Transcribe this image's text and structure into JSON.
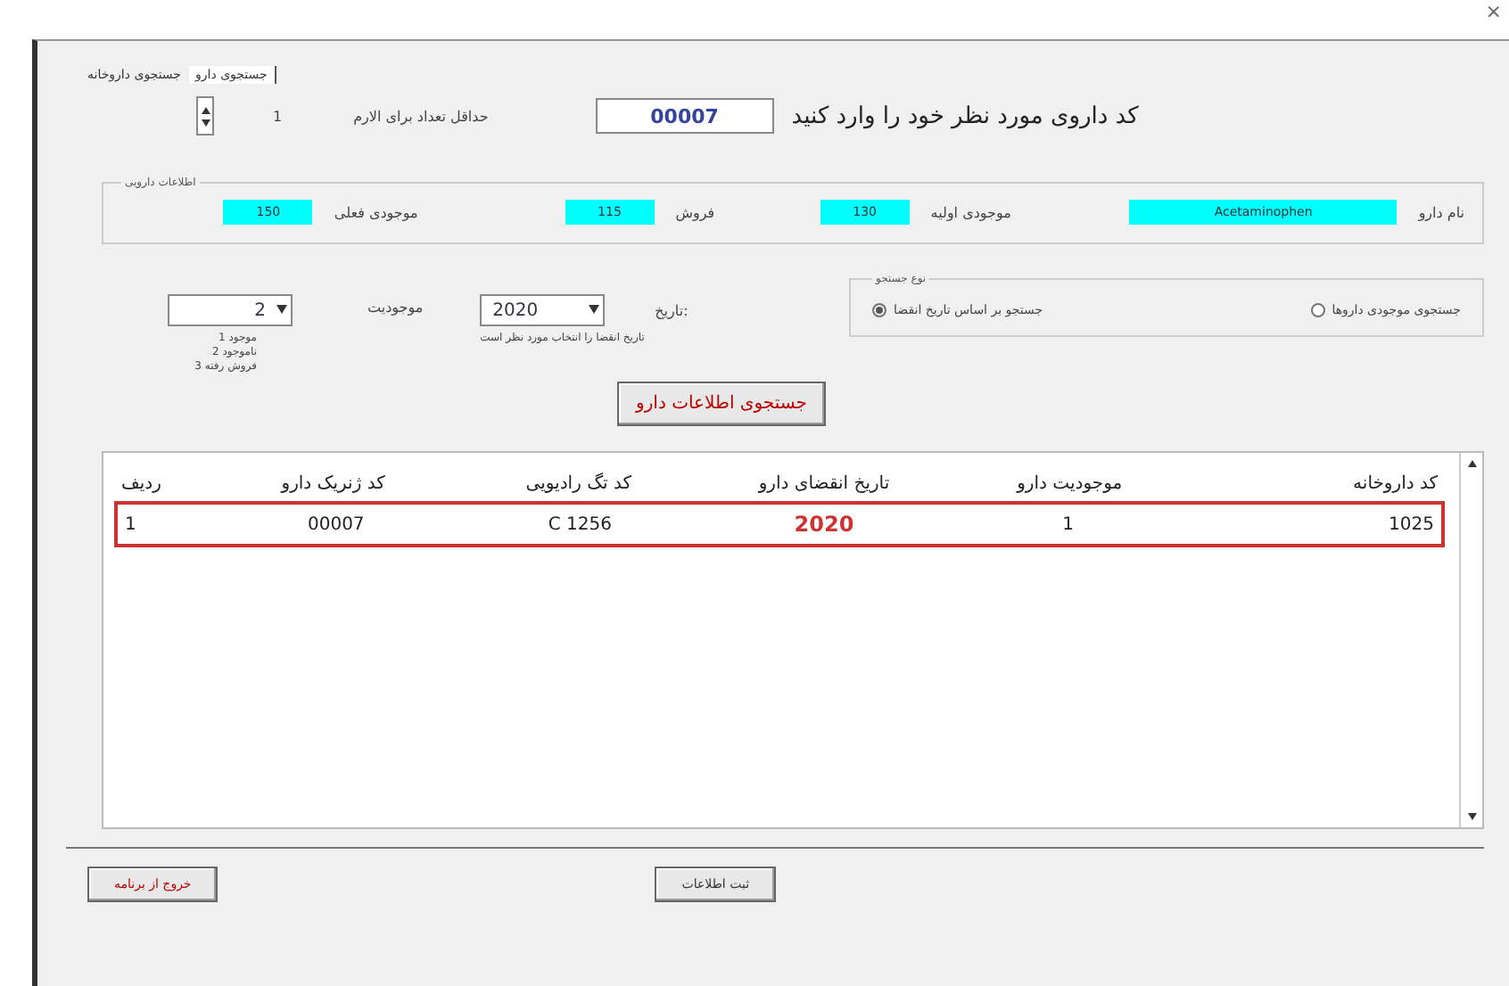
{
  "window": {
    "close": "×"
  },
  "tabs": [
    {
      "label": "جستجوی دارو",
      "selected": true
    },
    {
      "label": "جستجوی داروخانه",
      "selected": false
    }
  ],
  "code_prompt": {
    "label": "کد داروی مورد نظر خود را وارد کنید",
    "value": "00007"
  },
  "alarm": {
    "label": "حداقل تعداد برای الارم",
    "value": "1"
  },
  "drug_info": {
    "title": "اطلاعات دارویی",
    "fields": [
      {
        "label": "نام دارو",
        "value": "Acetaminophen",
        "wide": true
      },
      {
        "label": "موجودی اولیه",
        "value": "130",
        "wide": false
      },
      {
        "label": "فروش",
        "value": "115",
        "wide": false
      },
      {
        "label": "موجودی فعلی",
        "value": "150",
        "wide": false
      }
    ]
  },
  "date": {
    "label": "تاریخ:",
    "value": "2020",
    "hint": "تاریخ انقضا را انتخاب مورد نظر است"
  },
  "availability": {
    "label": "موجودیت",
    "value": "2",
    "legend": [
      "1 موجود",
      "2 ناموجود",
      "3 فروش رفته"
    ]
  },
  "search_type": {
    "title": "نوع جستجو",
    "options": [
      {
        "label": "جستجوی موجودی داروها",
        "selected": false
      },
      {
        "label": "جستجو بر اساس تاریخ انقضا",
        "selected": true
      }
    ]
  },
  "search_button": "جستجوی اطلاعات دارو",
  "table": {
    "columns": [
      "کد داروخانه",
      "موجودیت دارو",
      "تاریخ انقضای دارو",
      "کد تگ رادیویی",
      "کد ژنریک دارو",
      "ردیف"
    ],
    "rows": [
      {
        "cells": [
          "1025",
          "1",
          "2020",
          "C 1256",
          "00007",
          "1"
        ],
        "selected": true
      }
    ]
  },
  "buttons": [
    {
      "label": "ثبت اطلاعات",
      "kind": "normal"
    },
    {
      "label": "خروج از برنامه",
      "kind": "danger"
    }
  ]
}
